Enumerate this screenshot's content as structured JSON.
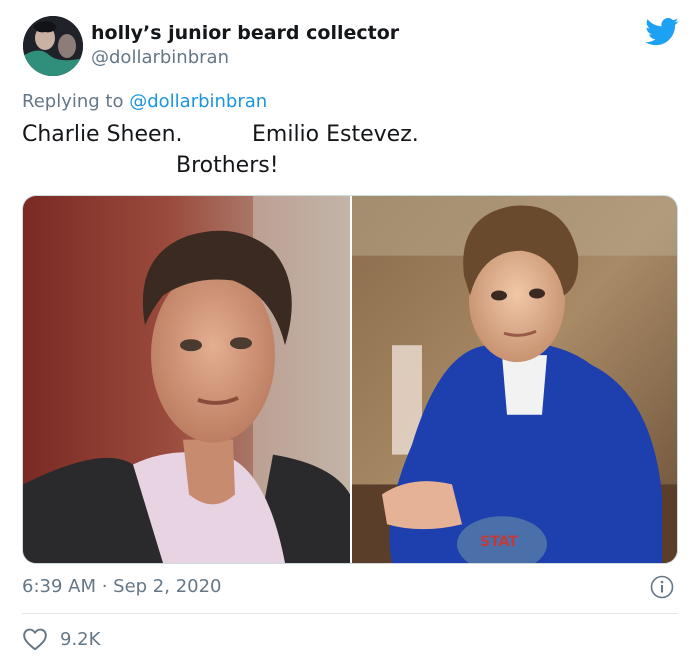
{
  "tweet": {
    "author_name": "holly’s junior beard collector",
    "author_handle": "@dollarbinbran",
    "reply_prefix": "Replying to",
    "reply_handle": "@dollarbinbran",
    "text_line1_a": "Charlie Sheen.",
    "text_line1_b": "Emilio Estevez.",
    "text_line2": "Brothers!",
    "timestamp": "6:39 AM · Sep 2, 2020",
    "like_count": "9.2K"
  },
  "media": {
    "left_photo": "charlie-sheen-photo",
    "right_photo": "emilio-estevez-photo",
    "jacket_text": "STAT"
  },
  "icons": {
    "brand": "twitter-bird-icon",
    "info": "info-icon",
    "like": "heart-icon"
  },
  "colors": {
    "twitter_blue": "#1da1f2",
    "secondary_text": "#657786",
    "link": "#1b95e0",
    "primary_text": "#14171a"
  }
}
